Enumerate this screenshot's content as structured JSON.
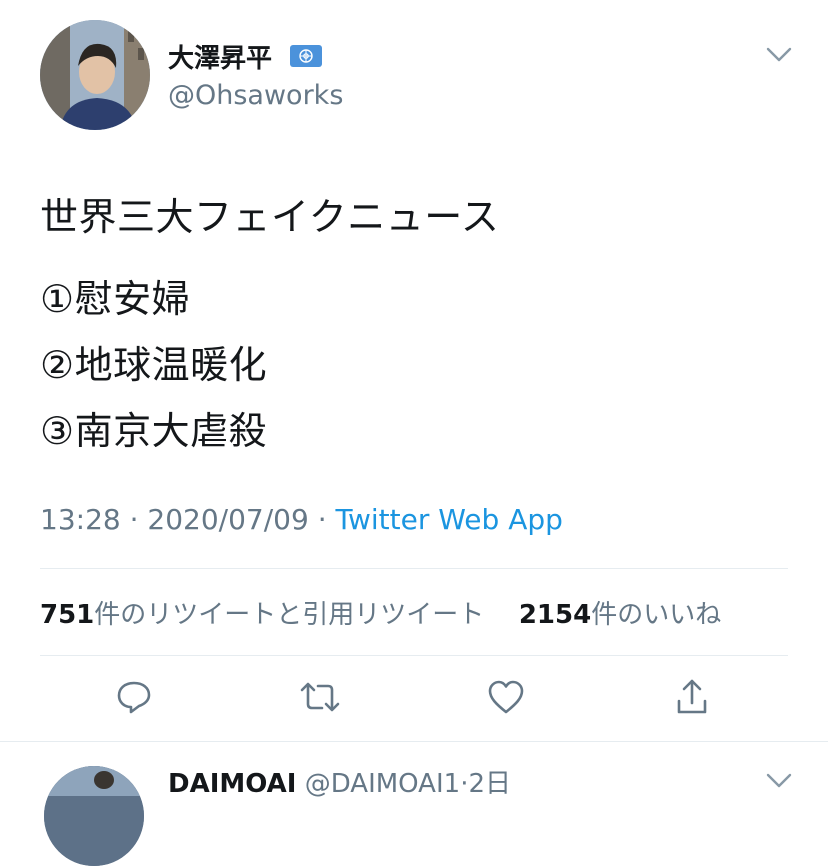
{
  "tweet": {
    "author_name": "大澤昇平",
    "author_handle": "@Ohsaworks",
    "lines": [
      "世界三大フェイクニュース",
      "①慰安婦",
      "②地球温暖化",
      "③南京大虐殺"
    ],
    "time": "13:28",
    "date": "2020/07/09",
    "separator": " · ",
    "source": "Twitter Web App",
    "retweet_count": "751",
    "retweet_label": "件のリツイートと引用リツイート",
    "like_count": "2154",
    "like_label": "件のいいね"
  },
  "actions": {
    "reply": "reply-icon",
    "retweet": "retweet-icon",
    "like": "heart-icon",
    "share": "share-icon"
  },
  "next_tweet": {
    "author_name": "DAIMOAI",
    "author_handle": "@DAIMOAI1",
    "age": "2日",
    "separator": "·"
  },
  "colors": {
    "text": "#14171a",
    "secondary": "#657786",
    "link": "#1b95e0",
    "divider": "#e6ecf0"
  }
}
